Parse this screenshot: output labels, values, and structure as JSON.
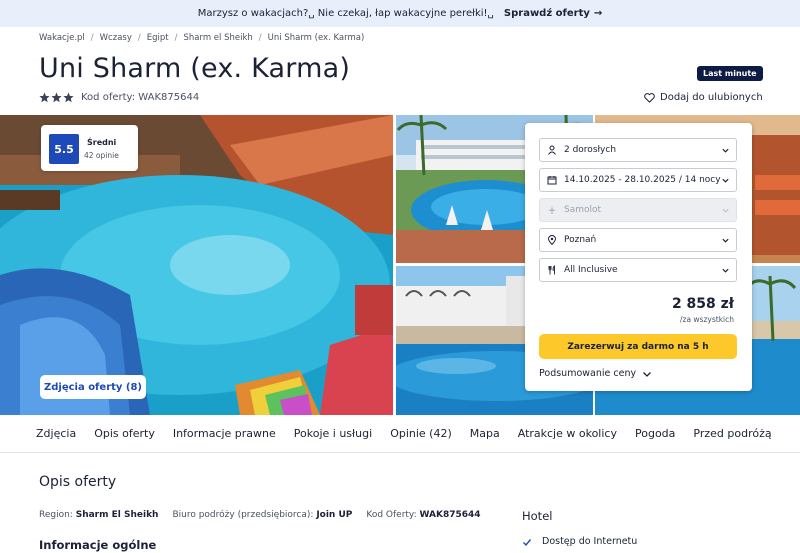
{
  "topbar": {
    "message": "Marzysz o wakacjach?␣ Nie czekaj, łap wakacyjne perełki!␣",
    "cta": "Sprawdź oferty",
    "arrow": "→"
  },
  "breadcrumb": [
    "Wakacje.pl",
    "Wczasy",
    "Egipt",
    "Sharm el Sheikh",
    "Uni Sharm (ex. Karma)"
  ],
  "hotel": {
    "name": "Uni Sharm (ex. Karma)",
    "stars": 3,
    "offer_code_label": "Kod oferty: WAK875644",
    "badge": "Last minute",
    "favorite_label": "Dodaj do ulubionych"
  },
  "rating": {
    "score": "5.5",
    "label": "Średni",
    "count": "42 opinie"
  },
  "gallery": {
    "photos_button": "Zdjęcia oferty (8)"
  },
  "booking": {
    "travelers": "2 dorosłych",
    "dates": "14.10.2025 - 28.10.2025 / 14 nocy",
    "transport": "Samolot",
    "departure": "Poznań",
    "board": "All Inclusive",
    "price": "2 858 zł",
    "price_note": "/za wszystkich",
    "book_label": "Zarezerwuj za darmo na 5 h",
    "summary_label": "Podsumowanie ceny"
  },
  "tabs": [
    "Zdjęcia",
    "Opis oferty",
    "Informacje prawne",
    "Pokoje i usługi",
    "Opinie (42)",
    "Mapa",
    "Atrakcje w okolicy",
    "Pogoda",
    "Przed podróżą"
  ],
  "description": {
    "title": "Opis oferty",
    "region_label": "Region:",
    "region_value": "Sharm El Sheikh",
    "operator_label": "Biuro podróży (przedsiębiorca):",
    "operator_value": "Join UP",
    "code_label": "Kod Oferty:",
    "code_value": "WAK875644",
    "general_info": "Informacje ogólne"
  },
  "hotel_features": {
    "title": "Hotel",
    "items": [
      "Dostęp do Internetu"
    ]
  },
  "colors": {
    "brand_blue": "#1e49b8",
    "navy": "#0e1c45",
    "cta_yellow": "#fcc82a",
    "topbar_bg": "#e9eefb",
    "star": "#3b4255"
  }
}
